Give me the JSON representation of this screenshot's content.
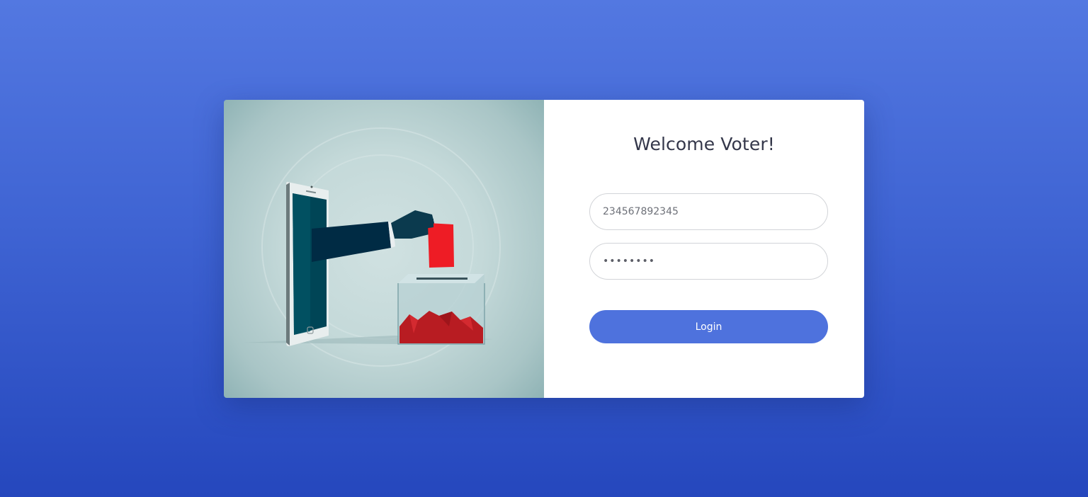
{
  "login": {
    "title": "Welcome Voter!",
    "voter_id_value": "234567892345",
    "password_value": "********",
    "login_label": "Login"
  },
  "illustration": {
    "icon": "mobile-voting-illustration-icon",
    "colors": {
      "background": "#c4d9d9",
      "phone_screen": "#004556",
      "sleeve": "#002b44",
      "ballot": "#ee1c25",
      "box_votes": "#b81c22"
    }
  },
  "colors": {
    "accent": "#4e72dd",
    "background_top": "#5378e1",
    "background_bottom": "#2547bd"
  }
}
